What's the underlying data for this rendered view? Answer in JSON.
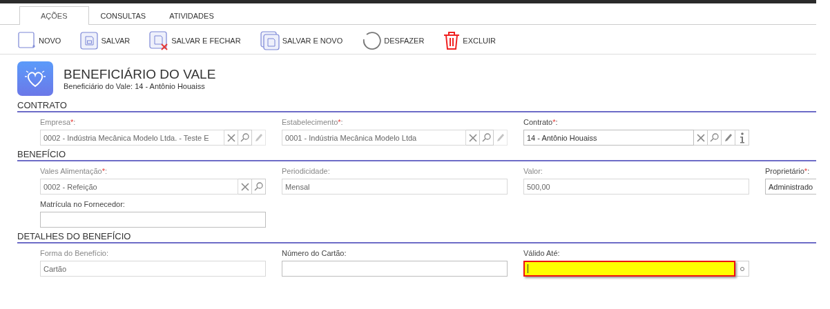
{
  "tabs": [
    {
      "label": "AÇÕES",
      "selected": true
    },
    {
      "label": "CONSULTAS",
      "selected": false
    },
    {
      "label": "ATIVIDADES",
      "selected": false
    }
  ],
  "toolbar": [
    {
      "kind": "new",
      "label": "NOVO"
    },
    {
      "kind": "save",
      "label": "SALVAR"
    },
    {
      "kind": "save_close",
      "label": "SALVAR E FECHAR"
    },
    {
      "kind": "save_new",
      "label": "SALVAR E NOVO"
    },
    {
      "kind": "undo",
      "label": "DESFAZER"
    },
    {
      "kind": "delete",
      "label": "EXCLUIR"
    }
  ],
  "header": {
    "title": "BENEFICIÁRIO DO VALE",
    "subtitle": "Beneficiário do Vale: 14 - Antônio Houaiss"
  },
  "sections": [
    {
      "title": "CONTRATO",
      "rows": [
        [
          {
            "label": "Empresa",
            "required": "*",
            "label_end": ":",
            "value": "0002 - Indústria Mecânica Modelo Ltda. - Teste E",
            "readonly": true,
            "buttons": [
              {
                "kind": "clear",
                "disabled": false
              },
              {
                "kind": "search",
                "disabled": false
              },
              {
                "kind": "edit",
                "disabled": true
              }
            ]
          },
          {
            "label": "Estabelecimento",
            "required": "*",
            "label_end": ":",
            "value": "0001 - Indústria Mecânica Modelo Ltda",
            "readonly": true,
            "buttons": [
              {
                "kind": "clear",
                "disabled": false
              },
              {
                "kind": "search",
                "disabled": false
              },
              {
                "kind": "edit",
                "disabled": true
              }
            ]
          },
          {
            "label": "Contrato",
            "required": "*",
            "label_end": ":",
            "value": "14 - Antônio Houaiss",
            "readonly": false,
            "buttons": [
              {
                "kind": "clear",
                "disabled": false
              },
              {
                "kind": "search",
                "disabled": false
              },
              {
                "kind": "edit",
                "disabled": false
              },
              {
                "kind": "info",
                "disabled": false
              }
            ]
          }
        ]
      ]
    },
    {
      "title": "BENEFÍCIO",
      "rows": [
        [
          {
            "label": "Vales Alimentação",
            "required": "*",
            "label_end": ":",
            "value": "0002 - Refeição",
            "readonly": true,
            "buttons": [
              {
                "kind": "clear",
                "disabled": false
              },
              {
                "kind": "search",
                "disabled": false
              }
            ]
          },
          {
            "label": "Periodicidade:",
            "readonly": true,
            "value": "Mensal"
          },
          {
            "label": "Valor:",
            "readonly": true,
            "value": "500,00"
          },
          {
            "label": "Proprietário",
            "required": "*",
            "label_end": ":",
            "readonly": false,
            "value": "Administrado"
          }
        ],
        [
          {
            "label": "Matrícula no Fornecedor:",
            "readonly": false
          }
        ]
      ]
    },
    {
      "title": "DETALHES DO BENEFÍCIO",
      "rows": [
        [
          {
            "label": "Forma do Benefício:",
            "readonly": true,
            "value": "Cartão"
          },
          {
            "label": "Número do Cartão:",
            "readonly": false
          },
          {
            "label": "Válido Até:",
            "readonly": false,
            "highlighted": true,
            "buttons": [
              {
                "kind": "calendar",
                "disabled": false
              }
            ]
          }
        ]
      ]
    }
  ]
}
